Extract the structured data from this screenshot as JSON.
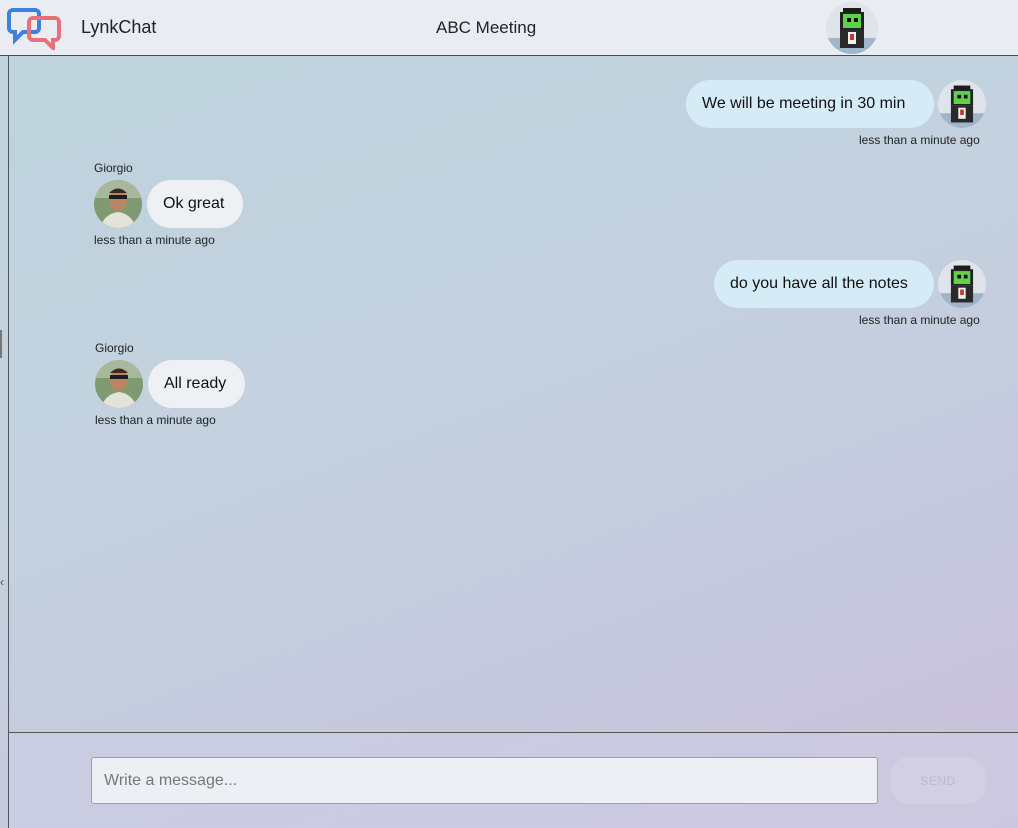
{
  "header": {
    "app_name": "LynkChat",
    "chat_title": "ABC Meeting",
    "logo_icon": "chat-bubbles-logo",
    "avatar_icon": "pixel-avatar-icon"
  },
  "messages": [
    {
      "from": "me",
      "text": "We will be meeting in 30 min",
      "time": "less than a minute ago"
    },
    {
      "from": "Giorgio",
      "sender": "Giorgio",
      "text": "Ok great",
      "time": "less than a minute ago"
    },
    {
      "from": "me",
      "text": "do you have all the notes",
      "time": "less than a minute ago"
    },
    {
      "from": "Giorgio",
      "sender": "Giorgio",
      "text": "All ready",
      "time": "less than a minute ago"
    }
  ],
  "composer": {
    "placeholder": "Write a message...",
    "value": "",
    "send_label": "SEND"
  },
  "colors": {
    "header_bg": "#e9edf3",
    "my_bubble": "#d5ecf7",
    "their_bubble": "#eef0f4",
    "logo_blue": "#3f7fe0",
    "logo_red": "#e8707a"
  }
}
